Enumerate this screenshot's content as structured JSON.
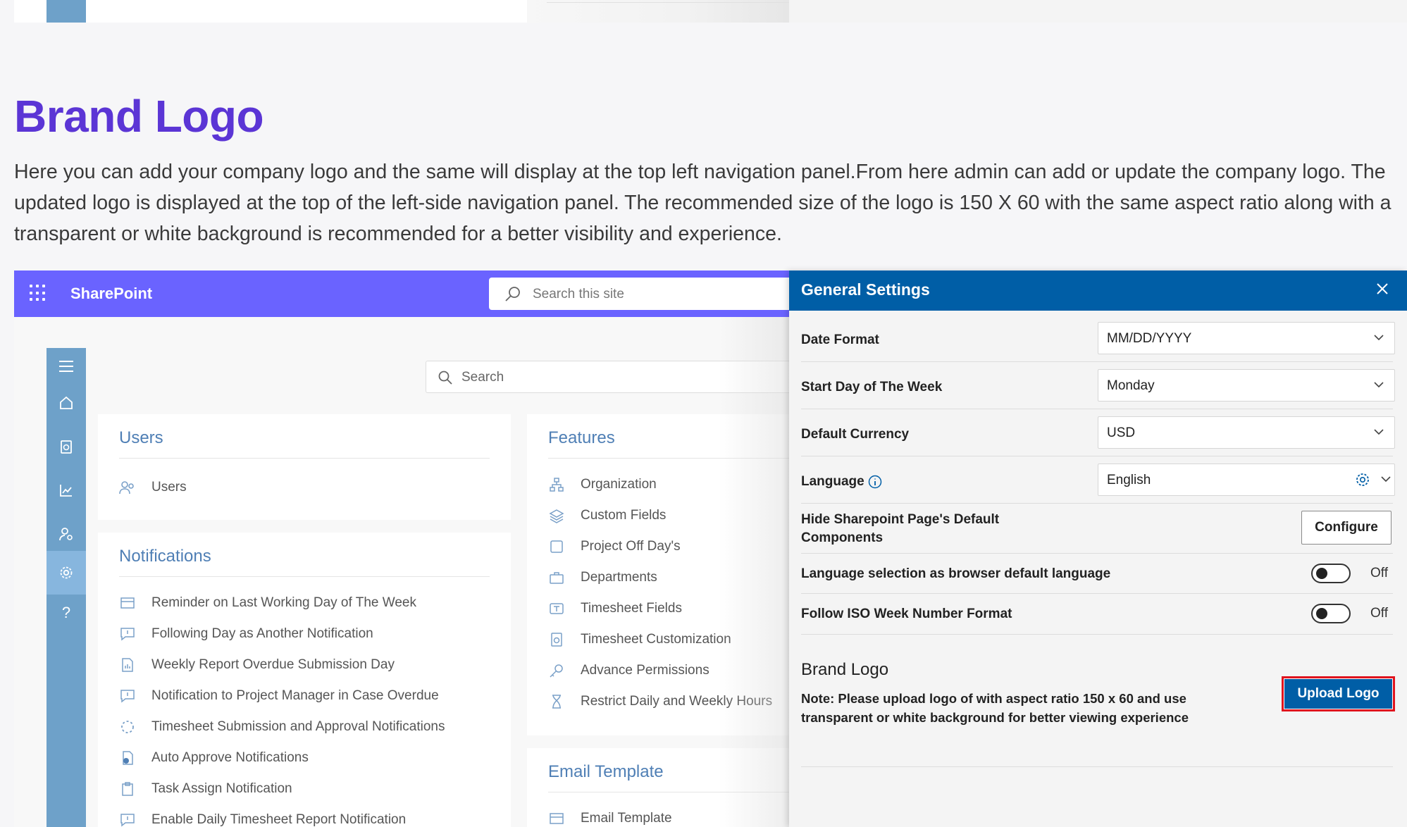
{
  "page": {
    "title": "Brand Logo",
    "description": "Here you can add your company logo and the same will display at the top left navigation panel.From here admin can add or update the company logo. The updated logo is displayed at the top of the left-side navigation panel. The recommended size of the logo is 150 X 60 with the same aspect ratio along with a transparent or white background is recommended for a better visibility and experience."
  },
  "sharepoint": {
    "app_name": "SharePoint",
    "search_placeholder": "Search this site",
    "main_search_placeholder": "Search"
  },
  "rail_icons": [
    "menu-icon",
    "home-icon",
    "timesheet-icon",
    "chart-icon",
    "user-settings-icon",
    "gear-icon",
    "help-icon"
  ],
  "cards": {
    "users": {
      "title": "Users",
      "items": [
        {
          "label": "Users",
          "icon": "users-icon"
        }
      ]
    },
    "notifications": {
      "title": "Notifications",
      "items": [
        {
          "label": "Reminder on Last Working Day of The Week",
          "icon": "reminder-icon"
        },
        {
          "label": "Following Day as Another Notification",
          "icon": "message-icon"
        },
        {
          "label": "Weekly Report Overdue Submission Day",
          "icon": "report-icon"
        },
        {
          "label": "Notification to Project Manager in Case Overdue",
          "icon": "message-icon"
        },
        {
          "label": "Timesheet Submission and Approval Notifications",
          "icon": "spinner-icon"
        },
        {
          "label": "Auto Approve Notifications",
          "icon": "approve-icon"
        },
        {
          "label": "Task Assign Notification",
          "icon": "clipboard-icon"
        },
        {
          "label": "Enable Daily Timesheet Report Notification",
          "icon": "message-icon"
        }
      ]
    },
    "features": {
      "title": "Features",
      "items": [
        {
          "label": "Organization",
          "icon": "org-chart-icon"
        },
        {
          "label": "Custom Fields",
          "icon": "layers-icon"
        },
        {
          "label": "Project Off Day's",
          "icon": "square-icon"
        },
        {
          "label": "Departments",
          "icon": "briefcase-icon"
        },
        {
          "label": "Timesheet Fields",
          "icon": "text-field-icon"
        },
        {
          "label": "Timesheet Customization",
          "icon": "timesheet-icon"
        },
        {
          "label": "Advance Permissions",
          "icon": "key-icon"
        },
        {
          "label": "Restrict Daily and Weekly Hours",
          "icon": "hourglass-icon"
        }
      ]
    },
    "email": {
      "title": "Email Template",
      "items": [
        {
          "label": "Email Template",
          "icon": "email-template-icon"
        }
      ]
    }
  },
  "panel": {
    "title": "General Settings",
    "date_format_label": "Date Format",
    "date_format_value": "MM/DD/YYYY",
    "start_day_label": "Start Day of The Week",
    "start_day_value": "Monday",
    "currency_label": "Default Currency",
    "currency_value": "USD",
    "language_label": "Language",
    "language_value": "English",
    "hide_components_label": "Hide Sharepoint Page's Default Components",
    "configure_label": "Configure",
    "browser_lang_label": "Language selection as browser default language",
    "browser_lang_state": "Off",
    "iso_week_label": "Follow ISO Week Number Format",
    "iso_week_state": "Off",
    "brand_logo_heading": "Brand Logo",
    "brand_logo_note": "Note: Please upload logo of with aspect ratio 150 x 60 and use transparent or white background for better viewing experience",
    "upload_label": "Upload Logo"
  },
  "colors": {
    "title": "#5b35d5",
    "sharepoint_bar": "#6a63ff",
    "rail": "#6ea1c9",
    "panel_header": "#005ea6",
    "highlight": "#e0141e"
  }
}
